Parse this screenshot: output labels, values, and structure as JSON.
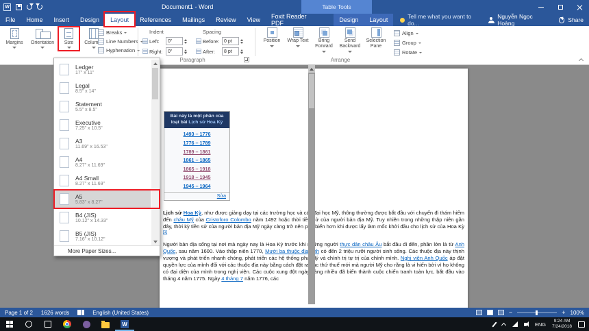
{
  "titlebar": {
    "title": "Document1 - Word",
    "context_label": "Table Tools"
  },
  "tabs_row": {
    "file": "File",
    "tabs": [
      "Home",
      "Insert",
      "Design",
      "Layout",
      "References",
      "Mailings",
      "Review",
      "View",
      "Foxit Reader PDF"
    ],
    "active_tab": "Layout",
    "context_tabs": [
      "Design",
      "Layout"
    ],
    "tell_me": "Tell me what you want to do...",
    "user_name": "Nguyễn Ngọc Hoàng",
    "share_label": "Share"
  },
  "ribbon": {
    "page_setup": {
      "buttons": [
        "Margins",
        "Orientation",
        "Size",
        "Columns"
      ],
      "small_buttons": [
        "Breaks",
        "Line Numbers",
        "Hyphenation"
      ]
    },
    "paragraph": {
      "group_label": "Paragraph",
      "indent_label": "Indent",
      "spacing_label": "Spacing",
      "left_label": "Left:",
      "left_value": "0\"",
      "right_label": "Right:",
      "right_value": "0\"",
      "before_label": "Before:",
      "before_value": "0 pt",
      "after_label": "After:",
      "after_value": "8 pt"
    },
    "arrange": {
      "group_label": "Arrange",
      "buttons": [
        "Position",
        "Wrap Text",
        "Bring Forward",
        "Send Backward",
        "Selection Pane"
      ],
      "small_buttons": [
        "Align",
        "Group",
        "Rotate"
      ]
    }
  },
  "size_dropdown": {
    "items": [
      {
        "name": "Ledger",
        "dims": "17\" x 11\""
      },
      {
        "name": "Legal",
        "dims": "8.5\" x 14\""
      },
      {
        "name": "Statement",
        "dims": "5.5\" x 8.5\""
      },
      {
        "name": "Executive",
        "dims": "7.25\" x 10.5\""
      },
      {
        "name": "A3",
        "dims": "11.69\" x 16.53\""
      },
      {
        "name": "A4",
        "dims": "8.27\" x 11.69\""
      },
      {
        "name": "A4 Small",
        "dims": "8.27\" x 11.69\""
      },
      {
        "name": "A5",
        "dims": "5.83\" x 8.27\"",
        "highlighted": true
      },
      {
        "name": "B4 (JIS)",
        "dims": "10.12\" x 14.33\""
      },
      {
        "name": "B5 (JIS)",
        "dims": "7.16\" x 10.12\""
      }
    ],
    "more_label": "More Paper Sizes..."
  },
  "document": {
    "infobox": {
      "header_prefix": "Bài này là một phần của loạt bài",
      "header_title": "Lịch sử Hoa Kỳ",
      "links": [
        {
          "label": "1493 – 1776",
          "visited": false
        },
        {
          "label": "1776 – 1789",
          "visited": false
        },
        {
          "label": "1789 – 1861",
          "visited": true
        },
        {
          "label": "1861 – 1865",
          "visited": false
        },
        {
          "label": "1865 – 1918",
          "visited": true
        },
        {
          "label": "1918 – 1945",
          "visited": true
        },
        {
          "label": "1945 – 1964",
          "visited": false
        }
      ],
      "edit_link": "Sửa"
    },
    "para1": [
      {
        "text": "Lịch sử "
      },
      {
        "text": "Hoa Kỳ"
      },
      {
        "text": ", như được giảng dạy tại các trường học và các đại học Mỹ, thông thường được bắt đầu với chuyến đi thám hiểm đến "
      },
      {
        "text": "châu Mỹ"
      },
      {
        "text": " của "
      },
      {
        "text": "Cristoforo Colombo"
      },
      {
        "text": " năm 1492 hoặc thời tiền sử của người bản địa Mỹ. Tuy nhiên trong những thập niên gần đây, thời kỳ tiền sử của người bản địa Mỹ ngày càng trở nên phổ biến hơn khi được lấy làm mốc khởi đầu cho lịch sử của Hoa Kỳ "
      },
      {
        "text": "[1]"
      }
    ],
    "para2": [
      {
        "text": "Người bản địa sống tại nơi mà ngày nay là Hoa Kỳ trước khi những người "
      },
      {
        "text": "thực dân châu Âu"
      },
      {
        "text": " bắt đầu đi đến, phần lớn là từ "
      },
      {
        "text": "Anh Quốc"
      },
      {
        "text": ", sau năm 1600. Vào thập niên 1770, "
      },
      {
        "text": "Mười ba thuộc địa Anh"
      },
      {
        "text": " có đến 2 triệu rưỡi người sinh sống. Các thuộc địa này thịnh vượng và phát triển nhanh chóng, phát triển các hệ thống pháp lý và chính trị tự trị của chính mình. "
      },
      {
        "text": "Nghị viện Anh Quốc"
      },
      {
        "text": " áp đặt quyền lực của mình đối với các thuộc địa này bằng cách đặt ra các thứ thuế mới mà người Mỹ cho rằng là vi hiến bởi vì họ không có đại diện của mình trong nghị viện. Các cuộc xung đột ngày càng nhiều đã biến thành cuộc chiến tranh toàn lực, bắt đầu vào tháng 4 năm 1775. Ngày "
      },
      {
        "text": "4 tháng 7"
      },
      {
        "text": " năm 1776, các"
      }
    ]
  },
  "status_bar": {
    "page_info": "Page 1 of 2",
    "word_count": "1626 words",
    "language": "English (United States)",
    "zoom": "100%"
  },
  "taskbar": {
    "language": "ENG",
    "time": "9:24 AM",
    "date": "7/24/2018"
  },
  "colors": {
    "word_blue": "#2b579a",
    "context_blue": "#5585d2",
    "link": "#0563c1",
    "visited_link": "#954f72",
    "annotation_red": "#ee1c25",
    "infobox_header_bg": "#1f3864"
  }
}
